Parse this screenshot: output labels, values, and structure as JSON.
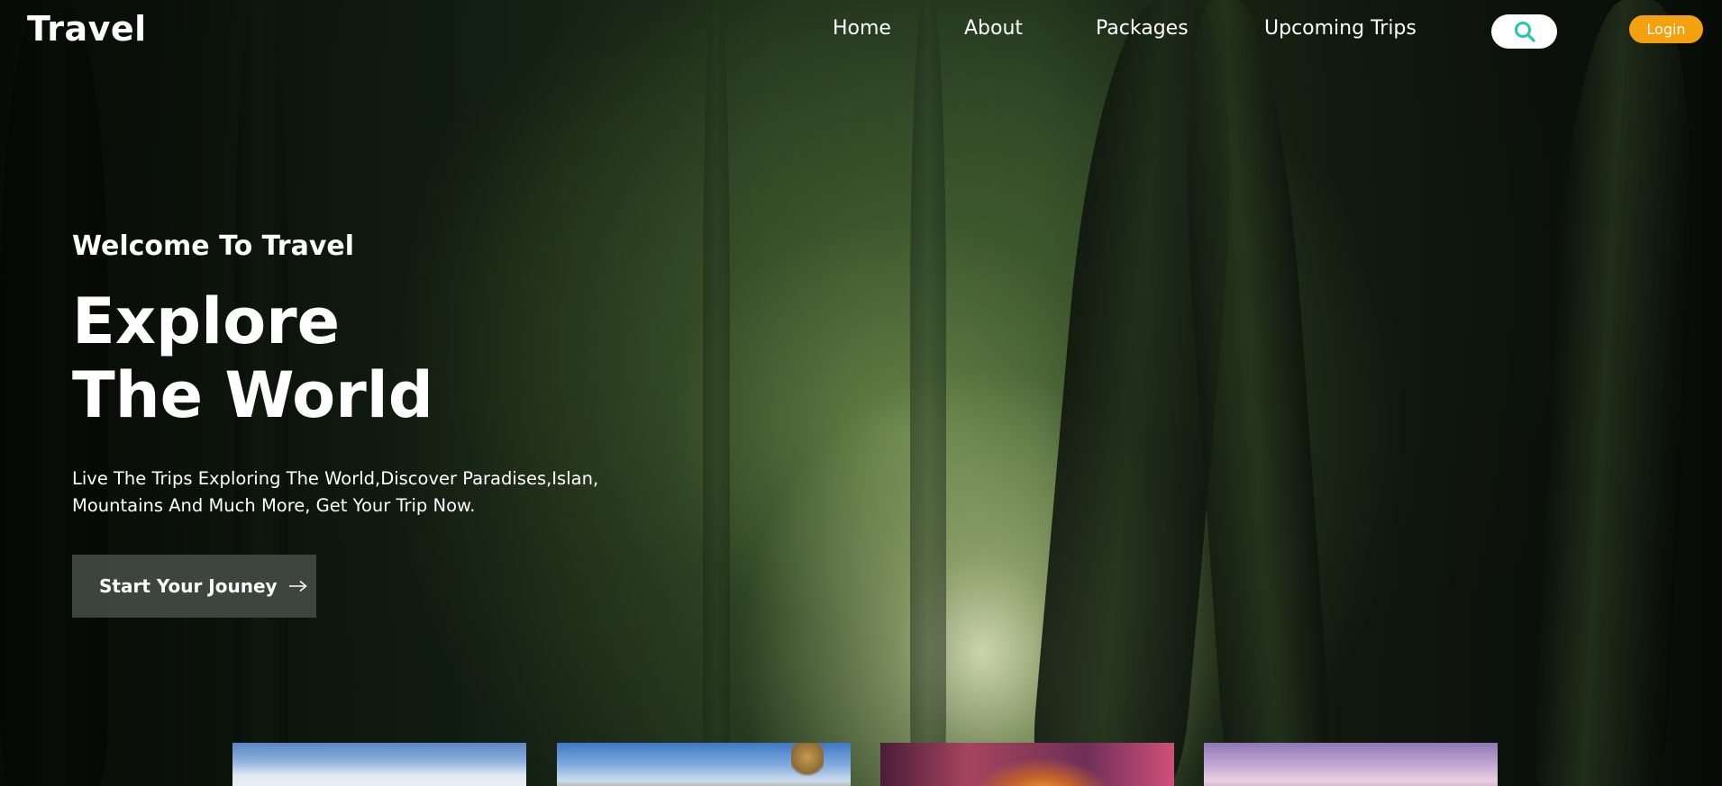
{
  "nav": {
    "brand": "Travel",
    "links": [
      "Home",
      "About",
      "Packages",
      "Upcoming Trips"
    ],
    "search_icon": "search-icon",
    "login_label": "Login"
  },
  "hero": {
    "welcome": "Welcome To Travel",
    "headline": [
      "Explore",
      "The World"
    ],
    "description": [
      "Live The Trips Exploring The World,Discover Paradises,Islan,",
      "Mountains And Much More, Get Your Trip Now."
    ],
    "cta_label": "Start Your Jouney",
    "cta_icon": "arrow-right-icon"
  },
  "colors": {
    "accent": "#f5a10f",
    "search_icon": "#22c9a8",
    "cta_bg": "#464c46"
  },
  "cards": [
    "sky-landscape",
    "blue-sky-tree",
    "arched-hall",
    "purple-sunset"
  ]
}
